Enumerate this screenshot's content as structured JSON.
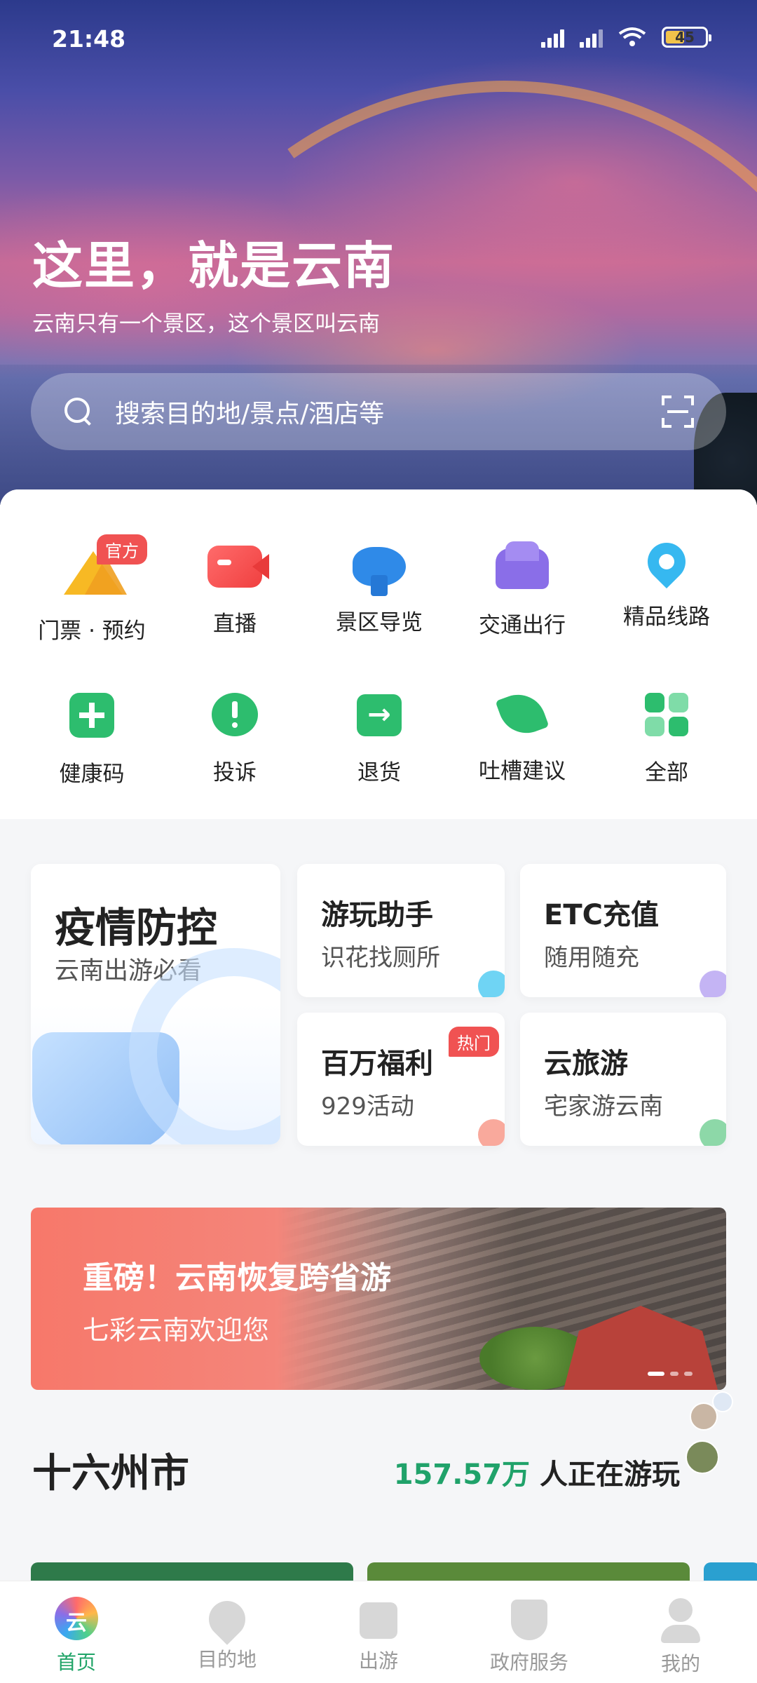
{
  "status_bar": {
    "time": "21:48",
    "battery": "45"
  },
  "hero": {
    "title": "这里，就是云南",
    "subtitle": "云南只有一个景区，这个景区叫云南",
    "search_placeholder": "搜索目的地/景点/酒店等"
  },
  "grid": {
    "items": [
      {
        "label": "门票 · 预约",
        "icon": "ticket-icon",
        "badge": "官方"
      },
      {
        "label": "直播",
        "icon": "live-camera-icon"
      },
      {
        "label": "景区导览",
        "icon": "guide-icon"
      },
      {
        "label": "交通出行",
        "icon": "car-icon"
      },
      {
        "label": "精品线路",
        "icon": "route-pin-icon"
      },
      {
        "label": "健康码",
        "icon": "health-code-icon"
      },
      {
        "label": "投诉",
        "icon": "complaint-icon"
      },
      {
        "label": "退货",
        "icon": "return-icon"
      },
      {
        "label": "吐槽建议",
        "icon": "suggestion-icon"
      },
      {
        "label": "全部",
        "icon": "all-apps-icon"
      }
    ]
  },
  "cards": {
    "epidemic": {
      "title": "疫情防控",
      "subtitle": "云南出游必看"
    },
    "assistant": {
      "title": "游玩助手",
      "subtitle": "识花找厕所"
    },
    "etc": {
      "title": "ETC充值",
      "subtitle": "随用随充"
    },
    "welfare": {
      "title": "百万福利",
      "subtitle": "929活动",
      "badge": "热门"
    },
    "cloud_travel": {
      "title": "云旅游",
      "subtitle": "宅家游云南"
    }
  },
  "banner": {
    "title": "重磅！云南恢复跨省游",
    "subtitle": "七彩云南欢迎您"
  },
  "cities": {
    "title": "十六州市",
    "count": "157.57万",
    "count_suffix": " 人正在游玩"
  },
  "tabbar": {
    "tabs": [
      {
        "label": "首页",
        "active": true
      },
      {
        "label": "目的地"
      },
      {
        "label": "出游"
      },
      {
        "label": "政府服务"
      },
      {
        "label": "我的"
      }
    ]
  },
  "colors": {
    "accent_green": "#21a468",
    "badge_red": "#f05252"
  }
}
